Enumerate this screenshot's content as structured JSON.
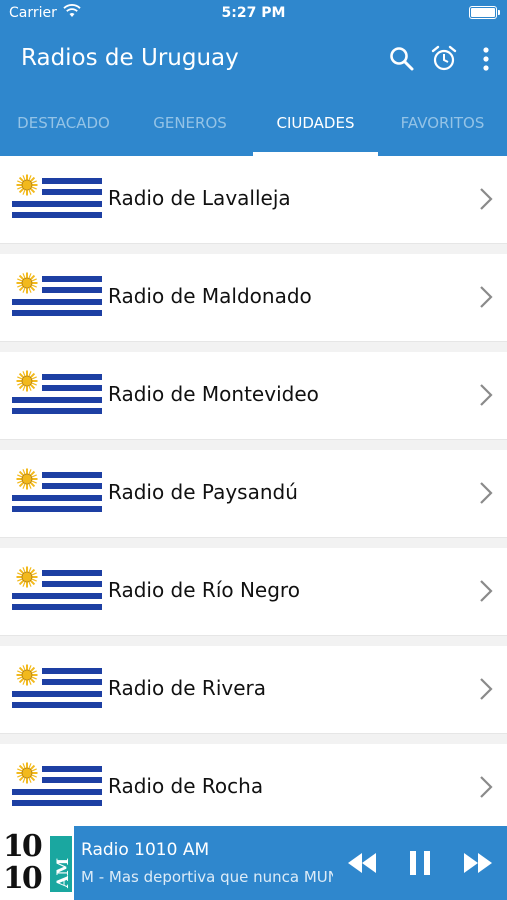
{
  "status_bar": {
    "carrier": "Carrier",
    "time": "5:27 PM"
  },
  "app_bar": {
    "title": "Radios de Uruguay",
    "icons": [
      "search-icon",
      "alarm-icon",
      "more-icon"
    ]
  },
  "tabs": [
    {
      "label": "DESTACADO",
      "active": false
    },
    {
      "label": "GENEROS",
      "active": false
    },
    {
      "label": "CIUDADES",
      "active": true
    },
    {
      "label": "FAVORITOS",
      "active": false
    }
  ],
  "list": [
    {
      "label": "Radio de Lavalleja"
    },
    {
      "label": "Radio de Maldonado"
    },
    {
      "label": "Radio de Montevideo"
    },
    {
      "label": "Radio de Paysandú"
    },
    {
      "label": "Radio de Río Negro"
    },
    {
      "label": "Radio de Rivera"
    },
    {
      "label": "Radio de Rocha"
    }
  ],
  "player": {
    "logo_line1": "10",
    "logo_line2": "10",
    "logo_am": "AM",
    "title": "Radio 1010 AM",
    "subtitle": "M - Mas deportiva que nunca MUNDIAL"
  },
  "colors": {
    "primary": "#2f87cd",
    "flag_blue": "#1d3fa3",
    "sun": "#f2b91c"
  }
}
